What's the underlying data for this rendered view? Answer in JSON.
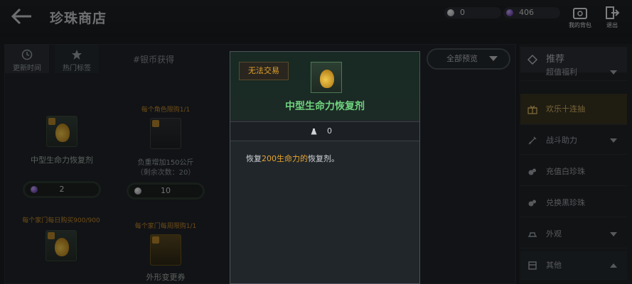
{
  "header": {
    "title": "珍珠商店",
    "silver_amount": "0",
    "pearl_amount": "406",
    "bag_label": "我的背包",
    "exit_label": "退出"
  },
  "tabs": {
    "update_label": "更新时间",
    "hot_label": "热门标签",
    "silver_label": "#银币获得"
  },
  "filter": {
    "label": "全部预览"
  },
  "cards": [
    {
      "limit": "",
      "name": "中型生命力恢复剂",
      "sub": "",
      "price": "2"
    },
    {
      "limit": "每个角色限购1/1",
      "name": "负重增加150公斤",
      "sub": "（剩余次数：20）",
      "price": "10"
    },
    {
      "limit": "每个家门每日购买900/900",
      "name": "",
      "sub": "",
      "price": ""
    },
    {
      "limit": "每个家门每周限购1/1",
      "name": "外形变更券",
      "sub": "",
      "price": ""
    }
  ],
  "side": {
    "header": "推荐",
    "items": [
      {
        "label": "超值福利"
      },
      {
        "label": "欢乐十连抽"
      },
      {
        "label": "战斗助力"
      },
      {
        "label": "充值白珍珠"
      },
      {
        "label": "兑换黑珍珠"
      },
      {
        "label": "外观"
      },
      {
        "label": "其他"
      }
    ]
  },
  "modal": {
    "badge": "无法交易",
    "item_name": "中型生命力恢复剂",
    "weight": "0",
    "desc_prefix": "恢复",
    "desc_highlight": "200生命力的",
    "desc_suffix": "恢复剂。"
  },
  "colors": {
    "rare_green": "#6fd27e",
    "warning_orange": "#e0a12a",
    "limit_orange": "#c98a2a"
  }
}
